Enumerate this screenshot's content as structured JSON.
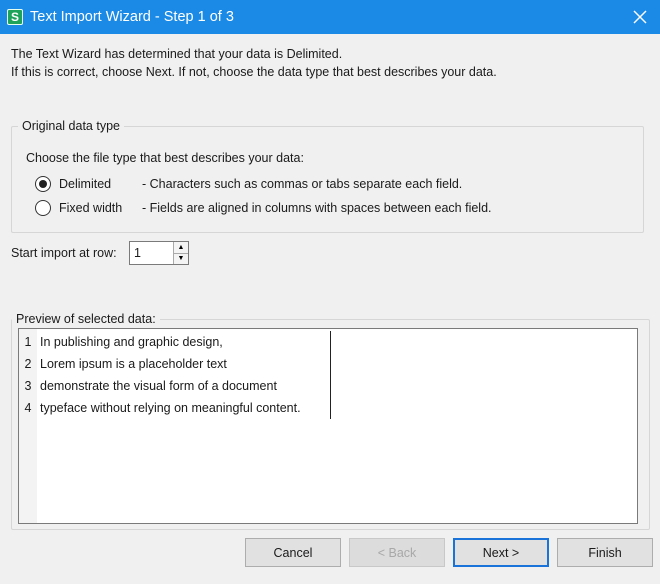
{
  "window": {
    "title": "Text Import Wizard - Step 1 of 3",
    "app_icon_letter": "S"
  },
  "intro": {
    "line1": "The Text Wizard has determined that your data is Delimited.",
    "line2": "If this is correct, choose Next. If not, choose the data type that best describes your data."
  },
  "original_type": {
    "legend": "Original data type",
    "prompt": "Choose the file type that best describes your data:",
    "options": [
      {
        "label": "Delimited",
        "description": "- Characters such as commas or tabs separate each field.",
        "selected": true
      },
      {
        "label": "Fixed width",
        "description": "- Fields are aligned in columns with spaces between each field.",
        "selected": false
      }
    ]
  },
  "start_row": {
    "label": "Start import at row:",
    "value": "1"
  },
  "preview": {
    "legend": "Preview of selected data:",
    "rows": [
      {
        "num": "1",
        "text": "In publishing and graphic design,"
      },
      {
        "num": "2",
        "text": "Lorem ipsum is a placeholder text"
      },
      {
        "num": "3",
        "text": "demonstrate the visual form of a document"
      },
      {
        "num": "4",
        "text": "typeface without relying on meaningful content."
      }
    ]
  },
  "buttons": {
    "cancel": "Cancel",
    "back": "< Back",
    "next": "Next >",
    "finish": "Finish"
  }
}
